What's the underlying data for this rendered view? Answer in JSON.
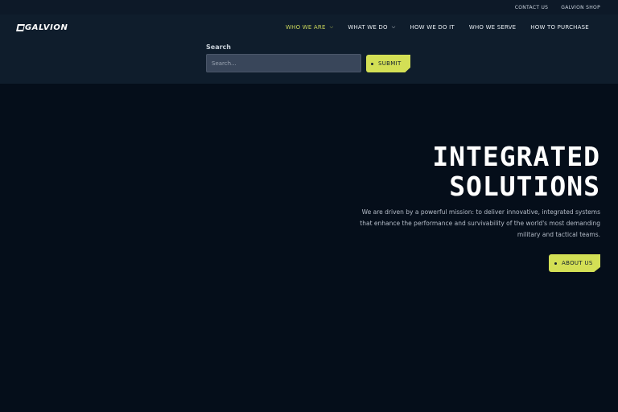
{
  "utility_nav": {
    "contact": "CONTACT US",
    "shop": "GALVION SHOP"
  },
  "logo": {
    "text": "GALVION"
  },
  "nav": {
    "items": [
      {
        "label": "WHO WE ARE",
        "chevron": true,
        "active": true
      },
      {
        "label": "WHAT WE DO",
        "chevron": true,
        "active": false
      },
      {
        "label": "HOW WE DO IT",
        "chevron": false,
        "active": false
      },
      {
        "label": "WHO WE SERVE",
        "chevron": false,
        "active": false
      },
      {
        "label": "HOW TO PURCHASE",
        "chevron": false,
        "active": false
      }
    ]
  },
  "search": {
    "label": "Search",
    "placeholder": "Search...",
    "submit_label": "SUBMIT"
  },
  "hero": {
    "title_line1": "INTEGRATED",
    "title_line2": "SOLUTIONS",
    "description": "We are driven by a powerful mission: to deliver innovative, integrated systems that enhance the performance and survivability of the world's most demanding military and tactical teams.",
    "cta_label": "ABOUT US"
  },
  "colors": {
    "background": "#050e1a",
    "header": "#0f1d2c",
    "accent": "#d3df55",
    "active_nav": "#c8d45a"
  },
  "icons": {
    "chevron": "chevron-down-icon",
    "button_dot": "dot-icon"
  }
}
